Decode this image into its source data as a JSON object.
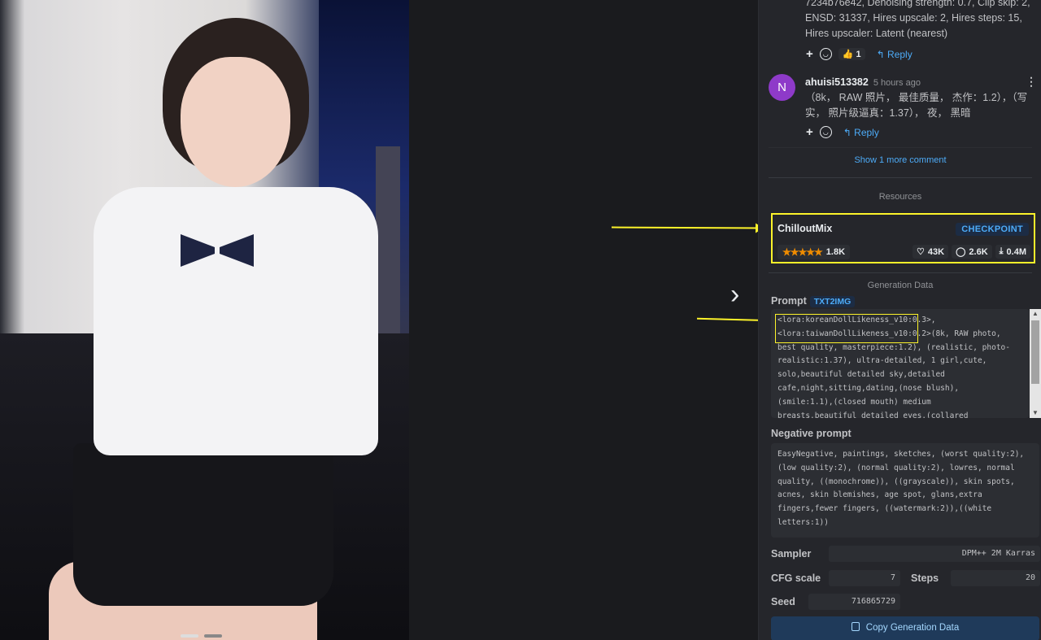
{
  "comments": {
    "first": {
      "text": "7234b76e42, Denoising strength: 0.7, Clip skip: 2, ENSD: 31337, Hires upscale: 2, Hires steps: 15, Hires upscaler: Latent (nearest)",
      "reaction_emoji": "👍",
      "reaction_count": "1",
      "reply_label": "Reply"
    },
    "second": {
      "avatar_letter": "N",
      "username": "ahuisi513382",
      "time": "5 hours ago",
      "text": "（8k， RAW 照片， 最佳质量， 杰作：1.2），（写实， 照片级逼真：1.37）， 夜， 黑暗",
      "reply_label": "Reply"
    },
    "show_more": "Show 1 more comment"
  },
  "resources": {
    "title": "Resources",
    "name": "ChilloutMix",
    "type_badge": "CHECKPOINT",
    "rating_stars": 5,
    "rating_count": "1.8K",
    "likes": "43K",
    "comments": "2.6K",
    "downloads": "0.4M"
  },
  "generation": {
    "title": "Generation Data",
    "prompt_label": "Prompt",
    "prompt_badge": "TXT2IMG",
    "prompt": "<lora:koreanDollLikeness_v10:0.3>, <lora:taiwanDollLikeness_v10:0.2>(8k, RAW photo, best quality, masterpiece:1.2), (realistic, photo-realistic:1.37), ultra-detailed, 1 girl,cute, solo,beautiful detailed sky,detailed cafe,night,sitting,dating,(nose blush), (smile:1.1),(closed mouth) medium breasts,beautiful detailed eyes,(collared",
    "negative_label": "Negative prompt",
    "negative_prompt": "EasyNegative, paintings, sketches, (worst quality:2), (low quality:2), (normal quality:2), lowres, normal quality, ((monochrome)), ((grayscale)), skin spots, acnes, skin blemishes, age spot, glans,extra fingers,fewer fingers, ((watermark:2)),((white letters:1))",
    "sampler_label": "Sampler",
    "sampler": "DPM++ 2M Karras",
    "cfg_label": "CFG scale",
    "cfg": "7",
    "steps_label": "Steps",
    "steps": "20",
    "seed_label": "Seed",
    "seed": "716865729",
    "copy_label": "Copy Generation Data"
  },
  "icons": {
    "next": "chevron-right-icon",
    "heart": "heart-icon",
    "comment": "comment-icon",
    "download": "download-icon",
    "copy": "copy-icon"
  },
  "colors": {
    "highlight": "#fcf32a",
    "link": "#4dabf7",
    "star": "#f08c00",
    "avatar": "#8e3ac9"
  }
}
